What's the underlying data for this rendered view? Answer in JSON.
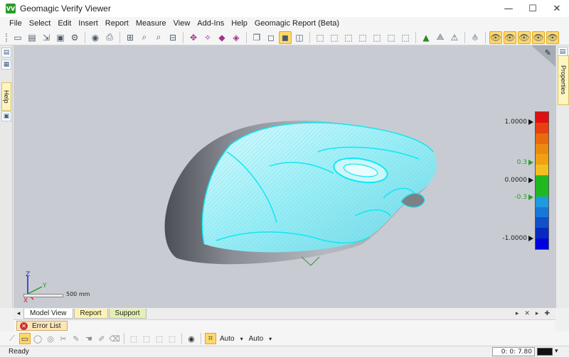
{
  "window": {
    "app_icon": "VV",
    "title": "Geomagic Verify Viewer",
    "minimize": "—",
    "maximize": "☐",
    "close": "✕"
  },
  "menu": [
    "File",
    "Select",
    "Edit",
    "Insert",
    "Report",
    "Measure",
    "View",
    "Add-Ins",
    "Help",
    "Geomagic Report (Beta)"
  ],
  "side": {
    "help_tab": "Help",
    "properties_tab": "Properties"
  },
  "colorbar": {
    "labels": {
      "top": "1.0000",
      "upper_tol": "0.3",
      "zero": "0.0000",
      "lower_tol": "-0.3",
      "bottom": "-1.0000"
    },
    "colors": [
      "#e01010",
      "#e84010",
      "#ea6a10",
      "#ec8a10",
      "#f0a010",
      "#f0c020",
      "#20b820",
      "#20b820",
      "#1f9ae0",
      "#1878d8",
      "#1050c8",
      "#0828c0",
      "#0000e0"
    ]
  },
  "scale": {
    "label": "500 mm"
  },
  "tabs": {
    "model_view": "Model View",
    "report": "Report",
    "support": "Support"
  },
  "error_list": {
    "label": "Error List"
  },
  "bottom": {
    "auto1": "Auto",
    "auto2": "Auto"
  },
  "status": {
    "text": "Ready",
    "coord": "0: 0: 7.80"
  }
}
